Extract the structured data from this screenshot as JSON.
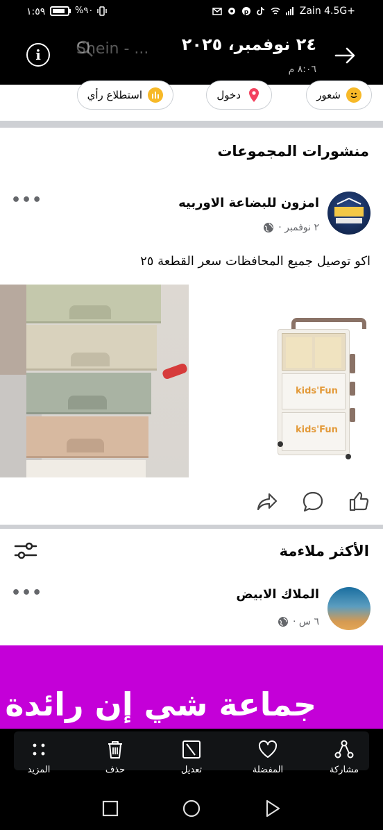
{
  "status_bar": {
    "time": "١:٥٩",
    "battery": "%٩٠",
    "carrier": "Zain 4.5G+",
    "signal_label": "36"
  },
  "top_bar": {
    "date": "٢٤ نوفمبر، ٢٠٢٥",
    "time": "٨:٠٦ م",
    "ghost_text": "Shein - ...",
    "info_icon": "info-icon",
    "back_icon": "arrow-right-icon"
  },
  "chips": [
    {
      "label": "شعور",
      "icon": "smile-icon",
      "color": "#f7b928"
    },
    {
      "label": "دخول",
      "icon": "location-pin-icon",
      "color": "#f3425f"
    },
    {
      "label": "استطلاع رأي",
      "icon": "poll-icon",
      "color": "#f7b928"
    }
  ],
  "groups_section": {
    "title": "منشورات المجموعات",
    "post": {
      "author": "امزون للبضاعة الاوربيه",
      "time": "٢ نوفمبر ·",
      "text": "اكو توصيل جميع المحافظات سعر القطعة ٢٥",
      "product_label_1": "kids'Fun",
      "product_label_2": "kids'Fun"
    }
  },
  "relevant_section": {
    "title": "الأكثر ملاءمة",
    "post": {
      "author": "الملاك الابيض",
      "time": "٦ س ·",
      "banner_text": "جماعة شي إن رائدة"
    }
  },
  "bottom_toolbar": {
    "items": [
      {
        "label": "المزيد",
        "icon": "more-dots-icon"
      },
      {
        "label": "حذف",
        "icon": "trash-icon"
      },
      {
        "label": "تعديل",
        "icon": "edit-icon"
      },
      {
        "label": "المفضلة",
        "icon": "heart-icon"
      },
      {
        "label": "مشاركة",
        "icon": "share-icon"
      }
    ]
  },
  "colors": {
    "accent_purple": "#c400d8",
    "bar_black": "#000000",
    "meta_gray": "#65676b"
  }
}
